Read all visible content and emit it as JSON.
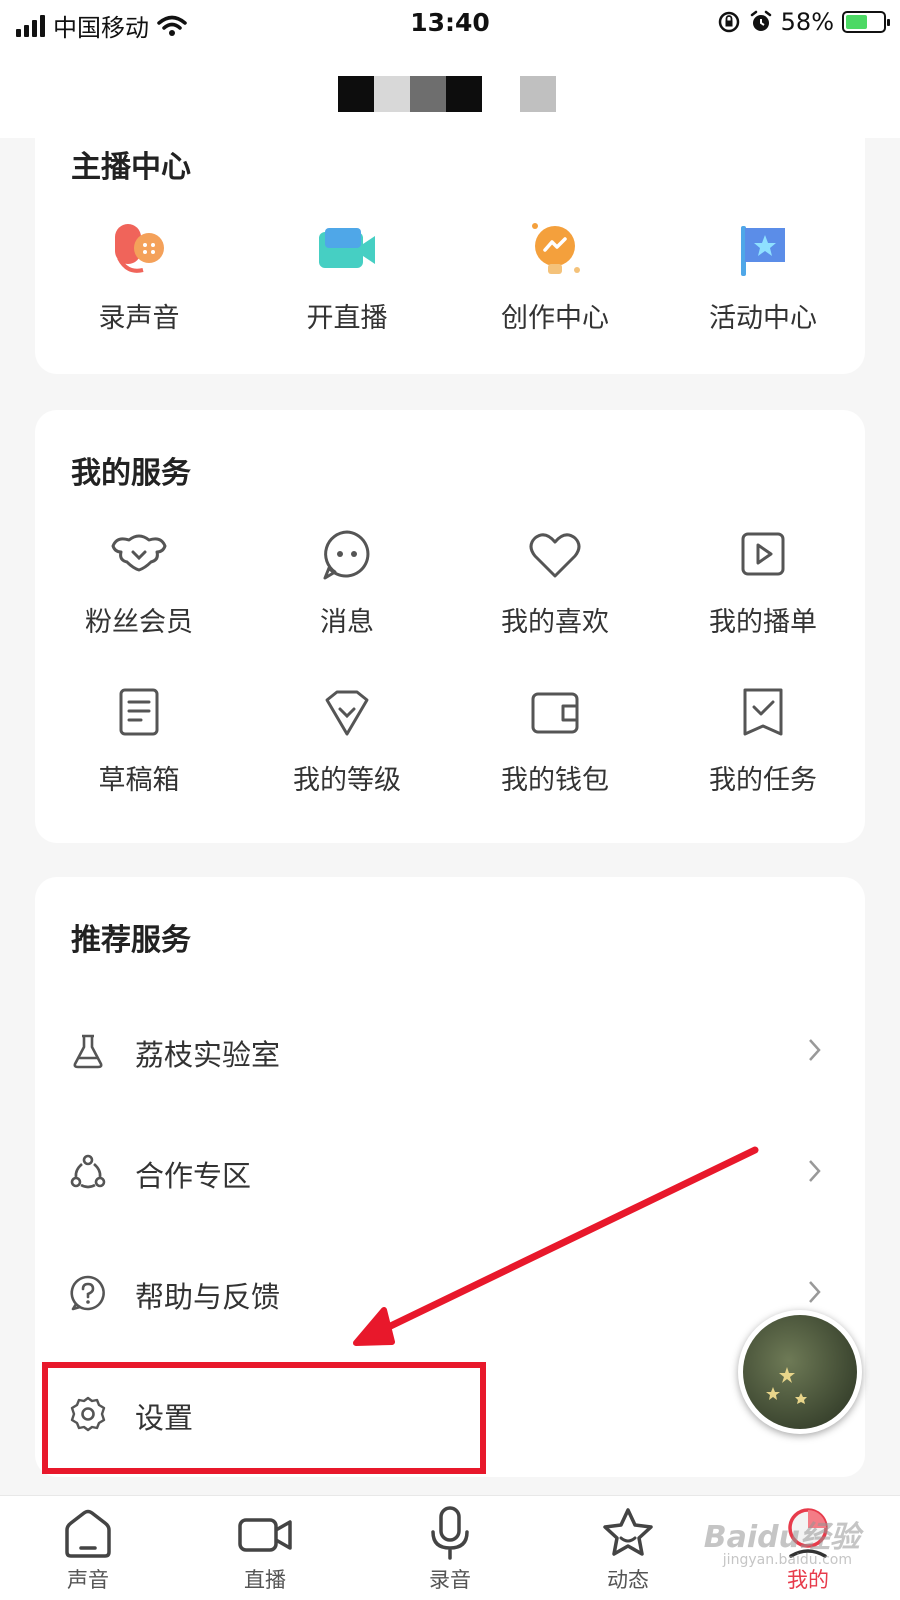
{
  "status_bar": {
    "carrier": "中国移动",
    "time": "13:40",
    "battery": "58%",
    "battery_level": 0.58
  },
  "anchor_center": {
    "title": "主播中心",
    "items": [
      {
        "label": "录声音",
        "icon": "record-voice-icon"
      },
      {
        "label": "开直播",
        "icon": "live-camera-icon"
      },
      {
        "label": "创作中心",
        "icon": "creation-bulb-icon"
      },
      {
        "label": "活动中心",
        "icon": "activity-flag-icon"
      }
    ]
  },
  "my_services": {
    "title": "我的服务",
    "items": [
      {
        "label": "粉丝会员",
        "icon": "fan-member-icon"
      },
      {
        "label": "消息",
        "icon": "message-icon"
      },
      {
        "label": "我的喜欢",
        "icon": "heart-icon"
      },
      {
        "label": "我的播单",
        "icon": "playlist-icon"
      },
      {
        "label": "草稿箱",
        "icon": "drafts-icon"
      },
      {
        "label": "我的等级",
        "icon": "level-icon"
      },
      {
        "label": "我的钱包",
        "icon": "wallet-icon"
      },
      {
        "label": "我的任务",
        "icon": "task-icon"
      }
    ]
  },
  "recommended_services": {
    "title": "推荐服务",
    "items": [
      {
        "label": "荔枝实验室",
        "icon": "flask-icon"
      },
      {
        "label": "合作专区",
        "icon": "cooperation-icon"
      },
      {
        "label": "帮助与反馈",
        "icon": "help-icon"
      },
      {
        "label": "设置",
        "icon": "gear-icon"
      }
    ]
  },
  "tabbar": {
    "items": [
      {
        "label": "声音",
        "icon": "home-icon"
      },
      {
        "label": "直播",
        "icon": "video-camera-icon"
      },
      {
        "label": "录音",
        "icon": "microphone-icon"
      },
      {
        "label": "动态",
        "icon": "star-icon"
      },
      {
        "label": "我的",
        "icon": "profile-icon"
      }
    ],
    "active_index": 4
  },
  "colors": {
    "accent": "#e73b4b",
    "annotation": "#e8182b"
  },
  "watermark": {
    "main": "Baidu经验",
    "sub": "jingyan.baidu.com"
  }
}
